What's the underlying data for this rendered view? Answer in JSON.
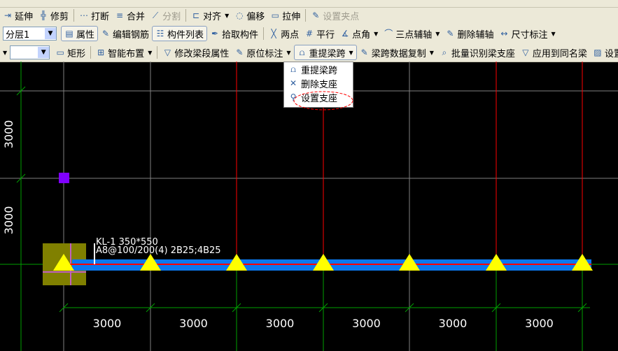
{
  "toolbar_row2": [
    {
      "label": "延伸",
      "icon": "extend-icon"
    },
    {
      "label": "修剪",
      "icon": "trim-icon"
    },
    {
      "label": "打断",
      "icon": "break-icon"
    },
    {
      "label": "合并",
      "icon": "merge-icon"
    },
    {
      "label": "分割",
      "icon": "split-icon",
      "disabled": true
    },
    {
      "label": "对齐",
      "icon": "align-icon",
      "dropdown": true
    },
    {
      "label": "偏移",
      "icon": "offset-icon"
    },
    {
      "label": "拉伸",
      "icon": "stretch-icon"
    },
    {
      "label": "设置夹点",
      "icon": "grip-icon",
      "disabled": true
    }
  ],
  "toolbar_row3": {
    "layer_select": "分层1",
    "buttons": [
      {
        "label": "属性",
        "icon": "properties-icon",
        "pressed": true
      },
      {
        "label": "编辑钢筋",
        "icon": "edit-rebar-icon"
      },
      {
        "label": "构件列表",
        "icon": "component-list-icon",
        "pressed": true
      },
      {
        "label": "拾取构件",
        "icon": "pick-icon"
      },
      {
        "label": "两点",
        "icon": "two-point-icon"
      },
      {
        "label": "平行",
        "icon": "parallel-icon"
      },
      {
        "label": "点角",
        "icon": "point-angle-icon",
        "dropdown": true
      },
      {
        "label": "三点辅轴",
        "icon": "three-point-axis-icon",
        "dropdown": true
      },
      {
        "label": "删除辅轴",
        "icon": "delete-axis-icon"
      },
      {
        "label": "尺寸标注",
        "icon": "dimension-icon",
        "dropdown": true
      }
    ]
  },
  "toolbar_row4": {
    "select_value": "",
    "buttons": [
      {
        "label": "矩形",
        "icon": "rectangle-icon"
      },
      {
        "label": "智能布置",
        "icon": "smart-layout-icon",
        "dropdown": true
      },
      {
        "label": "修改梁段属性",
        "icon": "modify-beam-icon"
      },
      {
        "label": "原位标注",
        "icon": "in-place-label-icon",
        "dropdown": true
      },
      {
        "label": "重提梁跨",
        "icon": "re-span-icon",
        "dropdown": true,
        "pressed": true
      },
      {
        "label": "梁跨数据复制",
        "icon": "copy-span-icon",
        "dropdown": true
      },
      {
        "label": "批量识别梁支座",
        "icon": "batch-support-icon"
      },
      {
        "label": "应用到同名梁",
        "icon": "apply-same-icon"
      },
      {
        "label": "设置上部",
        "icon": "set-top-icon"
      }
    ]
  },
  "dropdown_menu": [
    {
      "label": "重提梁跨",
      "icon": "re-span-icon"
    },
    {
      "label": "删除支座",
      "icon": "delete-support-icon"
    },
    {
      "label": "设置支座",
      "icon": "set-support-icon",
      "highlighted": true
    }
  ],
  "beam_label": {
    "line1": "KL-1 350*550",
    "line2": "A8@100/200(4) 2B25;4B25"
  },
  "span_dimensions": [
    "3000",
    "3000",
    "3000",
    "3000",
    "3000",
    "3000"
  ],
  "vertical_dimensions": [
    "3000",
    "3000"
  ],
  "colors": {
    "beam": "#0a78f0",
    "support": "#ffff00",
    "axis_red": "#ff0000",
    "axis_green": "#00a000",
    "column": "#808000",
    "annotation_ellipse": "#ff0000"
  }
}
